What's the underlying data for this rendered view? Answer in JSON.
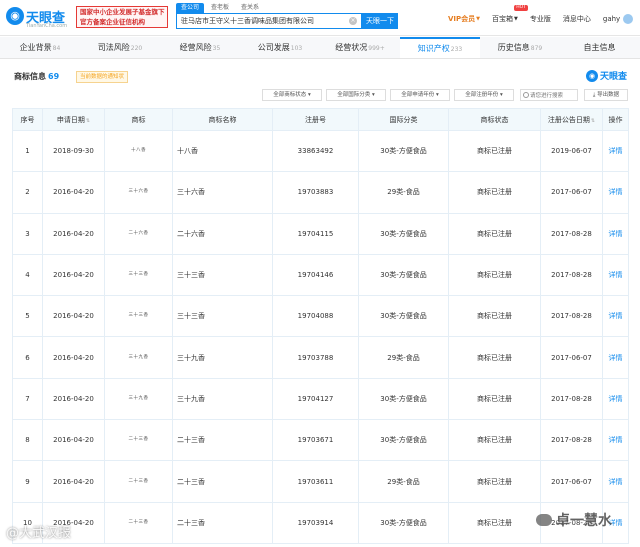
{
  "header": {
    "logo_text": "天眼查",
    "logo_sub": "TianYanCha.com",
    "promo_line1": "国家中小企业发展子基金旗下",
    "promo_line2": "官方备案企业征信机构",
    "search_tabs": [
      "查公司",
      "查老板",
      "查关系"
    ],
    "search_value": "驻马店市王守义十三香调味品集团有限公司",
    "search_button": "天眼一下",
    "nav": {
      "vip": "VIP会员",
      "baihe": "百宝箱",
      "hot": "HOT",
      "pro": "专业版",
      "messages": "消息中心",
      "user": "gahy"
    }
  },
  "tabs": [
    {
      "label": "企业背景",
      "count": "84"
    },
    {
      "label": "司法风险",
      "count": "220"
    },
    {
      "label": "经营风险",
      "count": "35"
    },
    {
      "label": "公司发展",
      "count": "103"
    },
    {
      "label": "经营状况",
      "count": "999+"
    },
    {
      "label": "知识产权",
      "count": "233"
    },
    {
      "label": "历史信息",
      "count": "879"
    },
    {
      "label": "自主信息",
      "count": ""
    }
  ],
  "section": {
    "title": "商标信息",
    "count": "69",
    "note": "当前数据的通知状",
    "brand": "天眼查"
  },
  "filters": {
    "status": "全部商标状态",
    "category": "全部国际分类",
    "apply_year": "全部申请年份",
    "register_year": "全部注册年份",
    "search_placeholder": "请您进行搜索",
    "export": "导出数据"
  },
  "table": {
    "headers": [
      "序号",
      "申请日期",
      "商标",
      "商标名称",
      "注册号",
      "国际分类",
      "商标状态",
      "注册公告日期",
      "操作"
    ],
    "rows": [
      {
        "no": "1",
        "date": "2018-09-30",
        "mark": "十八香",
        "name": "十八香",
        "reg": "33863492",
        "cls": "30类-方便食品",
        "status": "商标已注册",
        "pub": "2019-06-07",
        "op": "详情"
      },
      {
        "no": "2",
        "date": "2016-04-20",
        "mark": "三十六香",
        "name": "三十六香",
        "reg": "19703883",
        "cls": "29类-食品",
        "status": "商标已注册",
        "pub": "2017-06-07",
        "op": "详情"
      },
      {
        "no": "3",
        "date": "2016-04-20",
        "mark": "二十六香",
        "name": "二十六香",
        "reg": "19704115",
        "cls": "30类-方便食品",
        "status": "商标已注册",
        "pub": "2017-08-28",
        "op": "详情"
      },
      {
        "no": "4",
        "date": "2016-04-20",
        "mark": "三十三香",
        "name": "三十三香",
        "reg": "19704146",
        "cls": "30类-方便食品",
        "status": "商标已注册",
        "pub": "2017-08-28",
        "op": "详情"
      },
      {
        "no": "5",
        "date": "2016-04-20",
        "mark": "三十三香",
        "name": "三十三香",
        "reg": "19704088",
        "cls": "30类-方便食品",
        "status": "商标已注册",
        "pub": "2017-08-28",
        "op": "详情"
      },
      {
        "no": "6",
        "date": "2016-04-20",
        "mark": "三十九香",
        "name": "三十九香",
        "reg": "19703788",
        "cls": "29类-食品",
        "status": "商标已注册",
        "pub": "2017-06-07",
        "op": "详情"
      },
      {
        "no": "7",
        "date": "2016-04-20",
        "mark": "三十九香",
        "name": "三十九香",
        "reg": "19704127",
        "cls": "30类-方便食品",
        "status": "商标已注册",
        "pub": "2017-08-28",
        "op": "详情"
      },
      {
        "no": "8",
        "date": "2016-04-20",
        "mark": "二十三香",
        "name": "二十三香",
        "reg": "19703671",
        "cls": "30类-方便食品",
        "status": "商标已注册",
        "pub": "2017-08-28",
        "op": "详情"
      },
      {
        "no": "9",
        "date": "2016-04-20",
        "mark": "二十三香",
        "name": "二十三香",
        "reg": "19703611",
        "cls": "29类-食品",
        "status": "商标已注册",
        "pub": "2017-06-07",
        "op": "详情"
      },
      {
        "no": "10",
        "date": "2016-04-20",
        "mark": "二十三香",
        "name": "二十三香",
        "reg": "19703914",
        "cls": "30类-方便食品",
        "status": "商标已注册",
        "pub": "2017-08-28",
        "op": "详情"
      }
    ]
  },
  "watermarks": {
    "left": "@大武汉报",
    "right": "卓一慧水"
  },
  "colors": {
    "accent": "#128bed",
    "promo_red": "#d32f2f",
    "vip_orange": "#e67e22",
    "table_header_bg": "#f2f9fc"
  }
}
